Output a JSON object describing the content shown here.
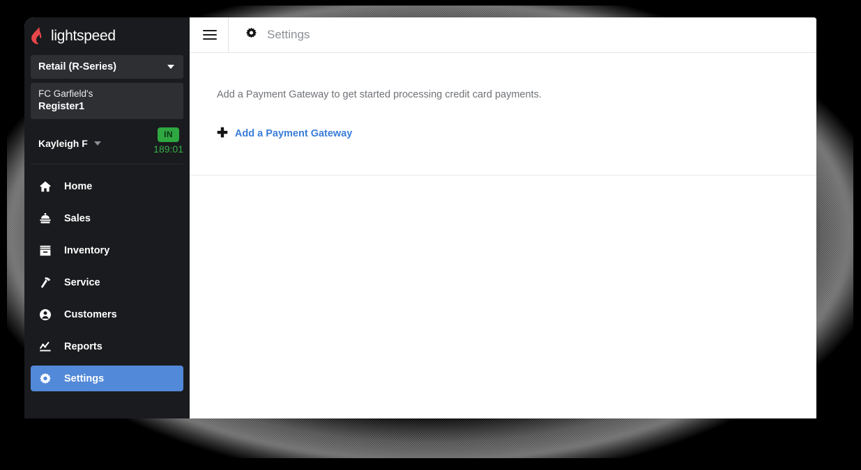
{
  "colors": {
    "sidebar_bg": "#1a1b1e",
    "sidebar_panel": "#2d2f33",
    "accent_blue": "#5289d8",
    "link_blue": "#3b7dd8",
    "brand_red": "#e8464a",
    "status_green": "#2ea840",
    "clock_green": "#36b14a",
    "content_bg": "#ffffff"
  },
  "sidebar": {
    "logo": {
      "icon": "lightspeed-flame-icon",
      "wordmark": "lightspeed"
    },
    "brand_select": {
      "label": "Retail (R-Series)",
      "caret_icon": "chevron-down-icon"
    },
    "register": {
      "store": "FC Garfield's",
      "register": "Register1"
    },
    "user": {
      "name": "Kayleigh F",
      "caret_icon": "chevron-down-icon",
      "status_badge": "IN",
      "clock_time": "189:01"
    },
    "items": [
      {
        "label": "Home",
        "icon": "home-icon",
        "active": false
      },
      {
        "label": "Sales",
        "icon": "sales-icon",
        "active": false
      },
      {
        "label": "Inventory",
        "icon": "inventory-icon",
        "active": false
      },
      {
        "label": "Service",
        "icon": "hammer-icon",
        "active": false
      },
      {
        "label": "Customers",
        "icon": "customer-icon",
        "active": false
      },
      {
        "label": "Reports",
        "icon": "chart-icon",
        "active": false
      },
      {
        "label": "Settings",
        "icon": "gear-icon",
        "active": true
      }
    ]
  },
  "topbar": {
    "menu_icon": "hamburger-menu-icon",
    "page_icon": "gear-icon",
    "title": "Settings"
  },
  "main": {
    "description": "Add a Payment Gateway to get started processing credit card payments.",
    "add_gateway": {
      "plus_icon": "plus-icon",
      "label": "Add a Payment Gateway"
    }
  }
}
